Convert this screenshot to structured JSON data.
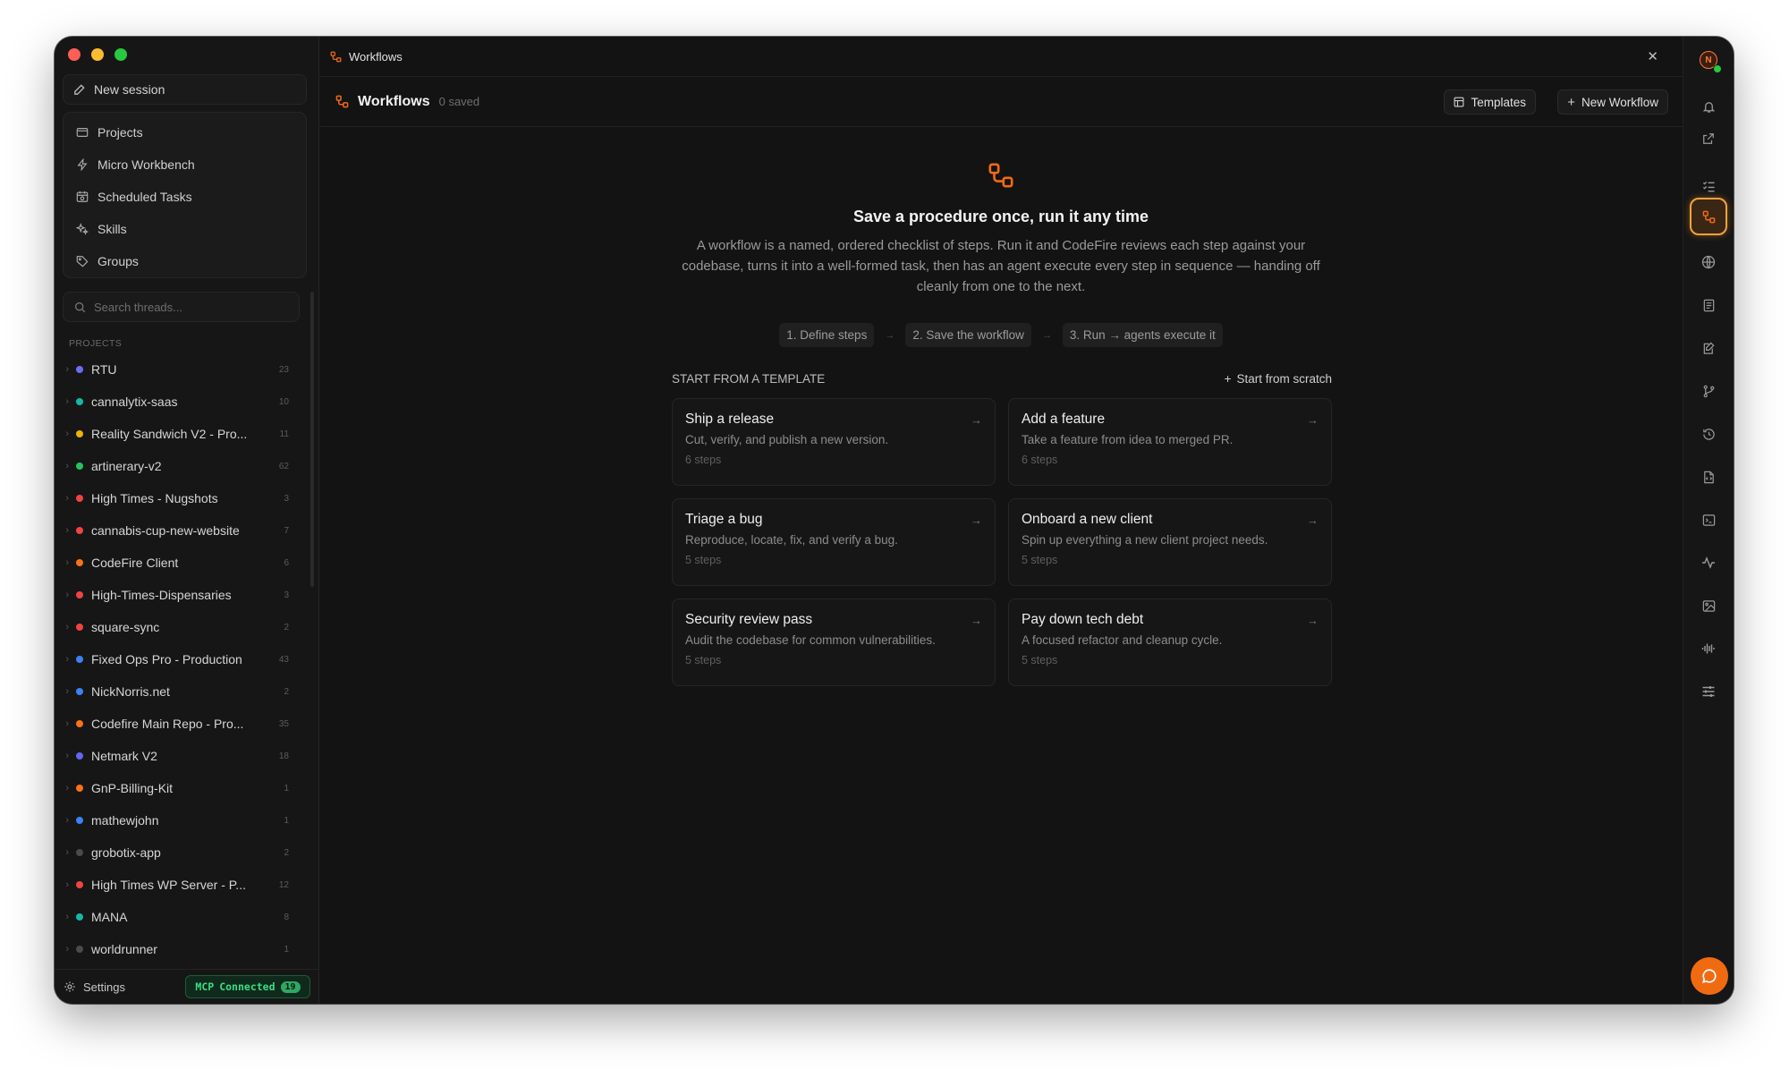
{
  "sidebar": {
    "new_session": "New session",
    "nav": [
      {
        "label": "Projects",
        "icon": "folder-icon"
      },
      {
        "label": "Micro Workbench",
        "icon": "bolt-icon"
      },
      {
        "label": "Scheduled Tasks",
        "icon": "calendar-clock-icon"
      },
      {
        "label": "Skills",
        "icon": "sparkle-icon"
      },
      {
        "label": "Groups",
        "icon": "tag-icon"
      }
    ],
    "search_placeholder": "Search threads...",
    "projects_label": "PROJECTS",
    "projects": [
      {
        "name": "RTU",
        "count": "23",
        "color": "#6b6ef5"
      },
      {
        "name": "cannalytix-saas",
        "count": "10",
        "color": "#14b8a6"
      },
      {
        "name": "Reality Sandwich V2 - Pro...",
        "count": "11",
        "color": "#eab308"
      },
      {
        "name": "artinerary-v2",
        "count": "62",
        "color": "#22c55e"
      },
      {
        "name": "High Times - Nugshots",
        "count": "3",
        "color": "#ef4444"
      },
      {
        "name": "cannabis-cup-new-website",
        "count": "7",
        "color": "#ef4444"
      },
      {
        "name": "CodeFire Client",
        "count": "6",
        "color": "#f97316"
      },
      {
        "name": "High-Times-Dispensaries",
        "count": "3",
        "color": "#ef4444"
      },
      {
        "name": "square-sync",
        "count": "2",
        "color": "#ef4444"
      },
      {
        "name": "Fixed Ops Pro - Production",
        "count": "43",
        "color": "#3b82f6"
      },
      {
        "name": "NickNorris.net",
        "count": "2",
        "color": "#3b82f6"
      },
      {
        "name": "Codefire Main Repo - Pro...",
        "count": "35",
        "color": "#f97316"
      },
      {
        "name": "Netmark V2",
        "count": "18",
        "color": "#6366f1"
      },
      {
        "name": "GnP-Billing-Kit",
        "count": "1",
        "color": "#f97316"
      },
      {
        "name": "mathewjohn",
        "count": "1",
        "color": "#3b82f6"
      },
      {
        "name": "grobotix-app",
        "count": "2",
        "color": "#4b4b4b"
      },
      {
        "name": "High Times WP Server - P...",
        "count": "12",
        "color": "#ef4444"
      },
      {
        "name": "MANA",
        "count": "8",
        "color": "#14b8a6"
      },
      {
        "name": "worldrunner",
        "count": "1",
        "color": "#4b4b4b"
      }
    ],
    "settings_label": "Settings",
    "mcp": {
      "label": "MCP",
      "status": "Connected",
      "count": "19"
    }
  },
  "tab": {
    "label": "Workflows"
  },
  "header": {
    "title": "Workflows",
    "subtitle": "0 saved",
    "templates_label": "Templates",
    "new_workflow_label": "New Workflow"
  },
  "hero": {
    "title": "Save a procedure once, run it any time",
    "body": "A workflow is a named, ordered checklist of steps. Run it and CodeFire reviews each step against your codebase, turns it into a well-formed task, then has an agent execute every step in sequence — handing off cleanly from one to the next."
  },
  "steps": [
    "1. Define steps",
    "2. Save the workflow",
    "3. Run → agents execute it"
  ],
  "templates": {
    "heading": "START FROM A TEMPLATE",
    "scratch_label": "Start from scratch",
    "items": [
      {
        "title": "Ship a release",
        "desc": "Cut, verify, and publish a new version.",
        "steps": "6 steps"
      },
      {
        "title": "Add a feature",
        "desc": "Take a feature from idea to merged PR.",
        "steps": "6 steps"
      },
      {
        "title": "Triage a bug",
        "desc": "Reproduce, locate, fix, and verify a bug.",
        "steps": "5 steps"
      },
      {
        "title": "Onboard a new client",
        "desc": "Spin up everything a new client project needs.",
        "steps": "5 steps"
      },
      {
        "title": "Security review pass",
        "desc": "Audit the codebase for common vulnerabilities.",
        "steps": "5 steps"
      },
      {
        "title": "Pay down tech debt",
        "desc": "A focused refactor and cleanup cycle.",
        "steps": "5 steps"
      }
    ]
  },
  "rail": {
    "avatar_initial": "N",
    "accent": "#f06a12"
  }
}
